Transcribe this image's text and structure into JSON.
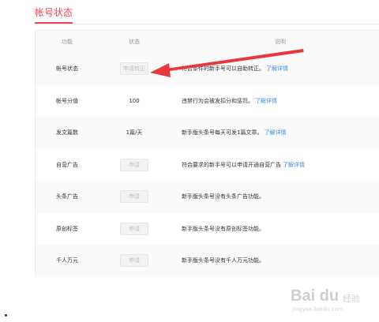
{
  "section": {
    "title": "帐号状态"
  },
  "table": {
    "headers": [
      "功能",
      "状态",
      "说明"
    ],
    "rows": [
      {
        "feature": "帐号状态",
        "status_type": "button",
        "status": "申请转正",
        "desc": "符合条件的新手号可以自助转正。",
        "link": "了解详情"
      },
      {
        "feature": "帐号分值",
        "status_type": "text",
        "status": "100",
        "desc": "违禁行为会被发扣分和惩罚。",
        "link": "了解详情"
      },
      {
        "feature": "发文篇数",
        "status_type": "text",
        "status": "1篇/天",
        "desc": "新手版头条号每天可发1篇文章。",
        "link": "了解详情"
      },
      {
        "feature": "自营广告",
        "status_type": "button",
        "status": "申请",
        "desc": "符合要求的新手号可以申请开通自营广告",
        "link": "了解详情"
      },
      {
        "feature": "头条广告",
        "status_type": "button",
        "status": "申请",
        "desc": "新手版头条号没有头条广告功能。",
        "link": ""
      },
      {
        "feature": "原创标签",
        "status_type": "button",
        "status": "申请",
        "desc": "新手版头条号没有原创标签功能。",
        "link": ""
      },
      {
        "feature": "千人万元",
        "status_type": "button",
        "status": "申请",
        "desc": "新手版头条号没有千人万元功能。",
        "link": ""
      }
    ]
  },
  "watermark": {
    "logo": "Bai du",
    "text": "经验",
    "url": "jingyan.baidu.com"
  },
  "colors": {
    "accent": "#f0454f",
    "link": "#3e8de3",
    "arrow": "#e8383d"
  }
}
